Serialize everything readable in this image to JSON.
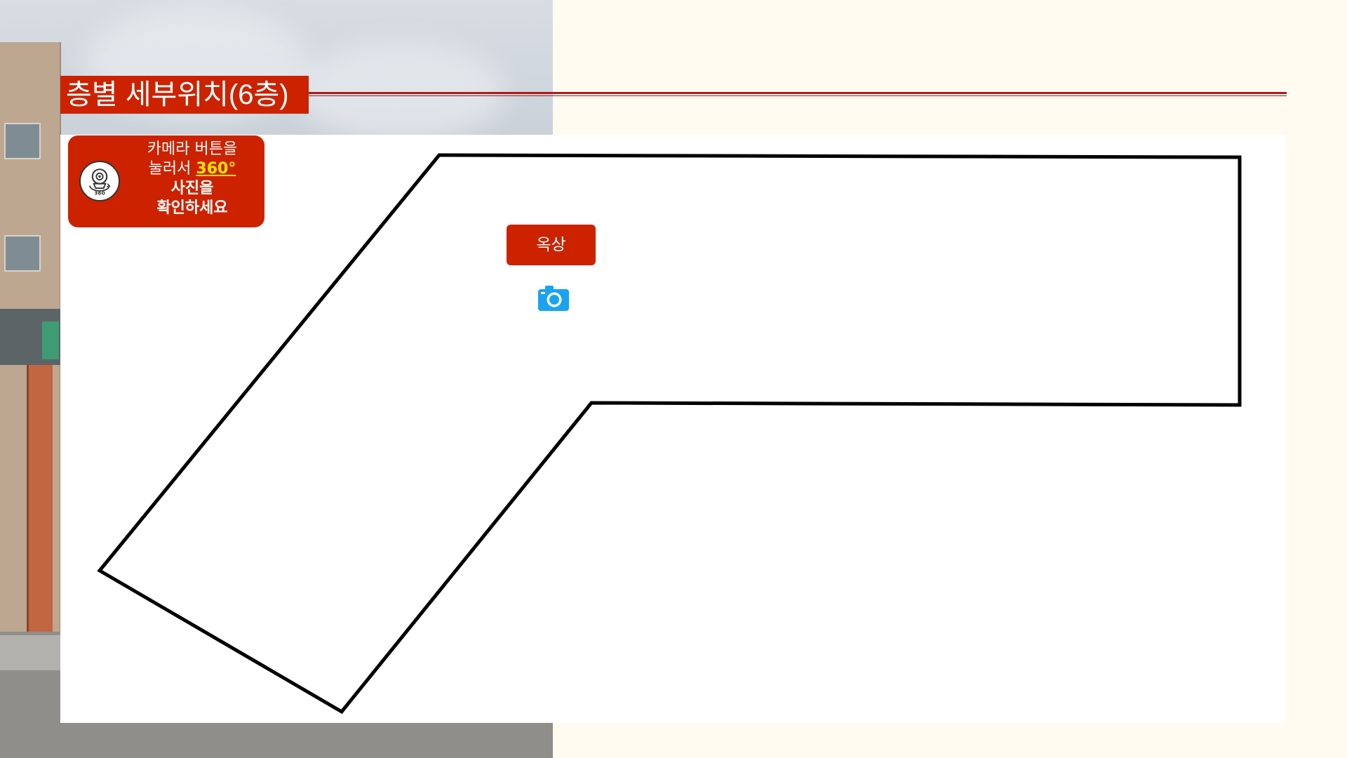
{
  "header": {
    "title": "층별 세부위치(6층)"
  },
  "instruction": {
    "line1": "카메라 버튼을",
    "line2_prefix": "눌러서 ",
    "line2_highlight": "360°",
    "line3": "사진을",
    "line4": "확인하세요",
    "icon_text": "360"
  },
  "map": {
    "locations": [
      {
        "label": "옥상",
        "icon": "camera-icon"
      }
    ]
  },
  "colors": {
    "accent": "#cc2200",
    "highlight": "#ffe600",
    "camera": "#1aa3f0",
    "background": "#fffbf1"
  }
}
